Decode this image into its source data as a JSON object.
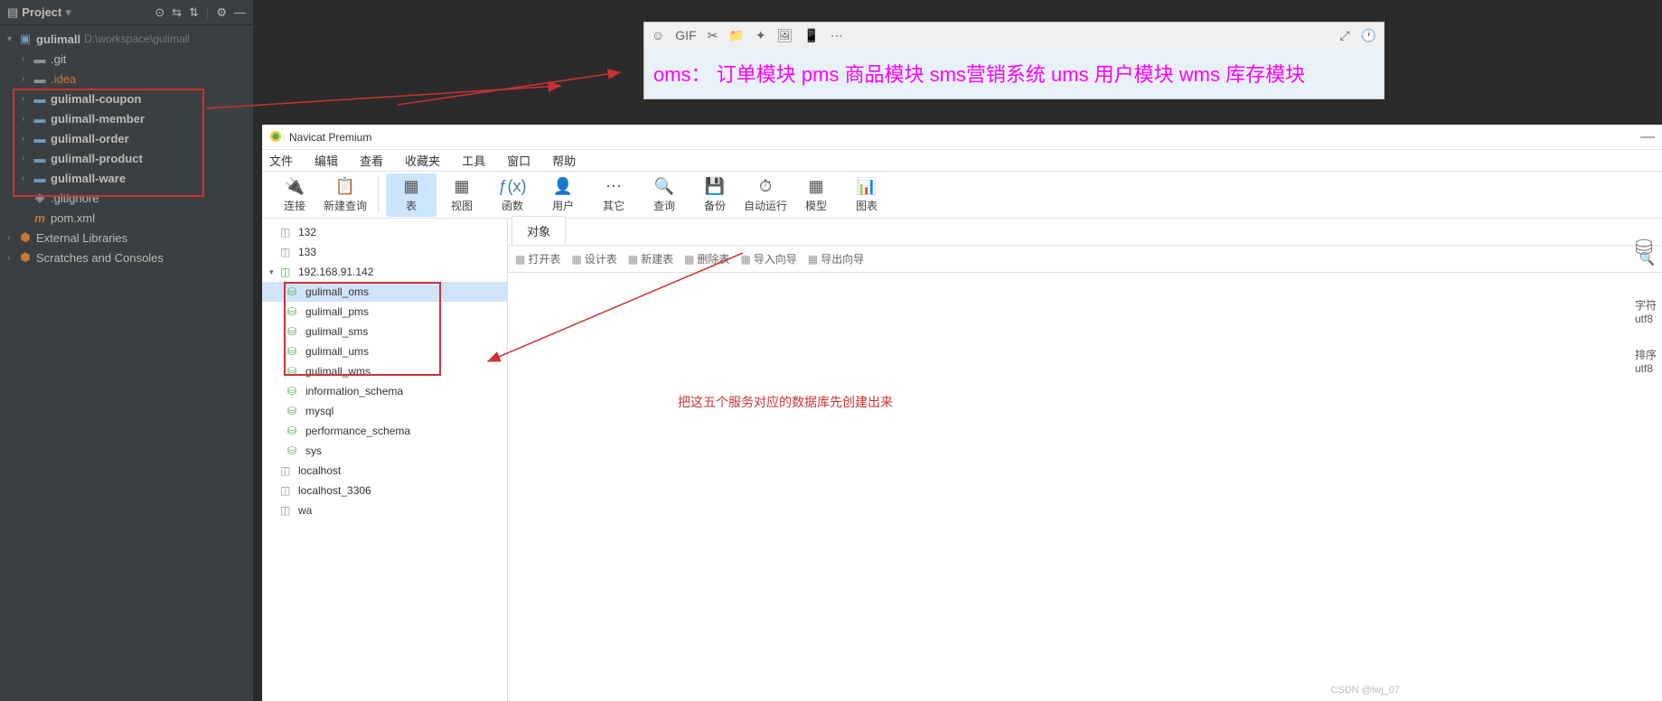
{
  "intellij": {
    "header": {
      "title": "Project"
    },
    "root": {
      "name": "gulimall",
      "path": "D:\\workspace\\gulimall"
    },
    "children": [
      {
        "name": ".git",
        "type": "folder"
      },
      {
        "name": ".idea",
        "type": "folder-idea"
      },
      {
        "name": "gulimall-coupon",
        "type": "module"
      },
      {
        "name": "gulimall-member",
        "type": "module"
      },
      {
        "name": "gulimall-order",
        "type": "module"
      },
      {
        "name": "gulimall-product",
        "type": "module"
      },
      {
        "name": "gulimall-ware",
        "type": "module"
      },
      {
        "name": ".gitignore",
        "type": "file"
      },
      {
        "name": "pom.xml",
        "type": "maven"
      }
    ],
    "extras": [
      {
        "name": "External Libraries"
      },
      {
        "name": "Scratches and Consoles"
      }
    ]
  },
  "note": {
    "text": "oms： 订单模块  pms 商品模块  sms营销系统 ums 用户模块 wms 库存模块"
  },
  "navicat": {
    "title": "Navicat Premium",
    "menu": [
      "文件",
      "编辑",
      "查看",
      "收藏夹",
      "工具",
      "窗口",
      "帮助"
    ],
    "toolbar": [
      {
        "label": "连接",
        "icon": "🔌"
      },
      {
        "label": "新建查询",
        "icon": "📋"
      }
    ],
    "toolbar2": [
      {
        "label": "表",
        "icon": "▦",
        "active": true
      },
      {
        "label": "视图",
        "icon": "▦"
      },
      {
        "label": "函数",
        "icon": "ƒ(x)"
      },
      {
        "label": "用户",
        "icon": "👤"
      },
      {
        "label": "其它",
        "icon": "⋯"
      },
      {
        "label": "查询",
        "icon": "🔍"
      },
      {
        "label": "备份",
        "icon": "💾"
      },
      {
        "label": "自动运行",
        "icon": "⏱"
      },
      {
        "label": "模型",
        "icon": "▦"
      },
      {
        "label": "图表",
        "icon": "📊"
      }
    ],
    "connections": [
      {
        "name": "132",
        "type": "conn"
      },
      {
        "name": "133",
        "type": "conn"
      },
      {
        "name": "192.168.91.142",
        "type": "conn-open",
        "open": true,
        "databases": [
          {
            "name": "gulimall_oms",
            "hl": true
          },
          {
            "name": "gulimall_pms",
            "hl": true
          },
          {
            "name": "gulimall_sms",
            "hl": true
          },
          {
            "name": "gulimall_ums",
            "hl": true
          },
          {
            "name": "gulimall_wms",
            "hl": true
          },
          {
            "name": "information_schema"
          },
          {
            "name": "mysql"
          },
          {
            "name": "performance_schema"
          },
          {
            "name": "sys"
          }
        ]
      },
      {
        "name": "localhost",
        "type": "conn"
      },
      {
        "name": "localhost_3306",
        "type": "conn"
      },
      {
        "name": "wa",
        "type": "conn"
      }
    ],
    "tab": "对象",
    "subtoolbar": [
      "打开表",
      "设计表",
      "新建表",
      "删除表",
      "导入向导",
      "导出向导"
    ],
    "sidebar": [
      {
        "label": "字符",
        "value": "utf8"
      },
      {
        "label": "排序",
        "value": "utf8"
      }
    ]
  },
  "annotations": {
    "text1": "把这五个服务对应的数据库先创建出来"
  },
  "watermark": "CSDN @lwj_07"
}
